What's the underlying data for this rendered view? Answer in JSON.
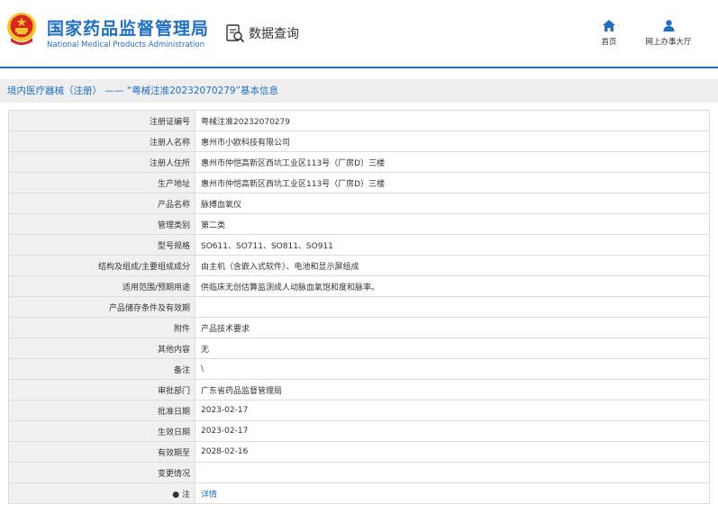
{
  "header": {
    "title_cn": "国家药品监督管理局",
    "title_en": "National Medical Products Administration",
    "query_label": "数据查询",
    "nav": {
      "home_label": "首页",
      "office_label": "网上办事大厅"
    },
    "colors": {
      "brand": "#1f6fc2",
      "logo_red": "#d7261e",
      "logo_gold": "#f4c430"
    }
  },
  "breadcrumb": {
    "section": "境内医疗器械（注册）",
    "separator": "——",
    "detail": "“粤械注准20232070279”基本信息"
  },
  "record": {
    "rows": [
      {
        "label": "注册证编号",
        "value": "粤械注准20232070279"
      },
      {
        "label": "注册人名称",
        "value": "惠州市小欧科技有限公司"
      },
      {
        "label": "注册人住所",
        "value": "惠州市仲恺高新区西坑工业区113号（厂房D）三楼"
      },
      {
        "label": "生产地址",
        "value": "惠州市仲恺高新区西坑工业区113号（厂房D）三楼"
      },
      {
        "label": "产品名称",
        "value": "脉搏血氧仪"
      },
      {
        "label": "管理类别",
        "value": "第二类"
      },
      {
        "label": "型号规格",
        "value": "SO611、SO711、SO811、SO911"
      },
      {
        "label": "结构及组成/主要组成成分",
        "value": "由主机（含嵌入式软件）、电池和显示屏组成"
      },
      {
        "label": "适用范围/预期用途",
        "value": "供临床无创估算监测成人动脉血氧饱和度和脉率。"
      },
      {
        "label": "产品储存条件及有效期",
        "value": ""
      },
      {
        "label": "附件",
        "value": "产品技术要求"
      },
      {
        "label": "其他内容",
        "value": "无"
      },
      {
        "label": "备注",
        "value": "\\"
      },
      {
        "label": "审批部门",
        "value": "广东省药品监督管理局"
      },
      {
        "label": "批准日期",
        "value": "2023-02-17"
      },
      {
        "label": "生效日期",
        "value": "2023-02-17"
      },
      {
        "label": "有效期至",
        "value": "2028-02-16"
      },
      {
        "label": "变更情况",
        "value": ""
      }
    ],
    "note": {
      "label": "注",
      "link": "详情"
    }
  }
}
